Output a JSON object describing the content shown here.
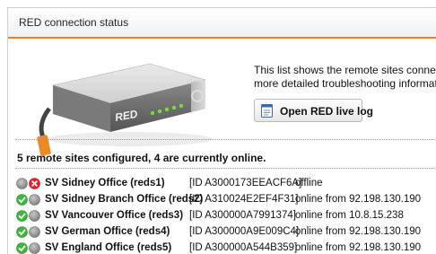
{
  "panel": {
    "title": "RED connection status"
  },
  "device": {
    "label": "RED"
  },
  "description": {
    "line1": "This list shows the remote sites connected",
    "line2": "more detailed troubleshooting information,"
  },
  "live_log_button": {
    "label": "Open RED live log",
    "icon": "log-document-icon"
  },
  "summary": "5 remote sites configured, 4 are currently online.",
  "colors": {
    "accent": "#ee7d22",
    "online": "#3fb53f",
    "offline": "#d9252b",
    "inactive": "#9a9a9a"
  },
  "sites": [
    {
      "name": "SV Sidney Office (reds1)",
      "id": "[ID A3000173EEACF6A]",
      "status": "offline",
      "icon1": "gray-dot-icon",
      "icon2": "offline-x-icon"
    },
    {
      "name": "SV Sidney Branch Office (reds2)",
      "id": "[ID A310024E2EF4F31]",
      "status": "online from 92.198.130.190",
      "icon1": "online-check-icon",
      "icon2": "gray-dot-icon"
    },
    {
      "name": "SV Vancouver Office (reds3)",
      "id": "[ID A300000A7991374]",
      "status": "online from 10.8.15.238",
      "icon1": "online-check-icon",
      "icon2": "gray-dot-icon"
    },
    {
      "name": "SV German Office (reds4)",
      "id": "[ID A300000A9E009C4]",
      "status": "online from 92.198.130.190",
      "icon1": "online-check-icon",
      "icon2": "gray-dot-icon"
    },
    {
      "name": "SV England Office (reds5)",
      "id": "[ID A300000A544B359]",
      "status": "online from 92.198.130.190",
      "icon1": "online-check-icon",
      "icon2": "gray-dot-icon"
    }
  ]
}
